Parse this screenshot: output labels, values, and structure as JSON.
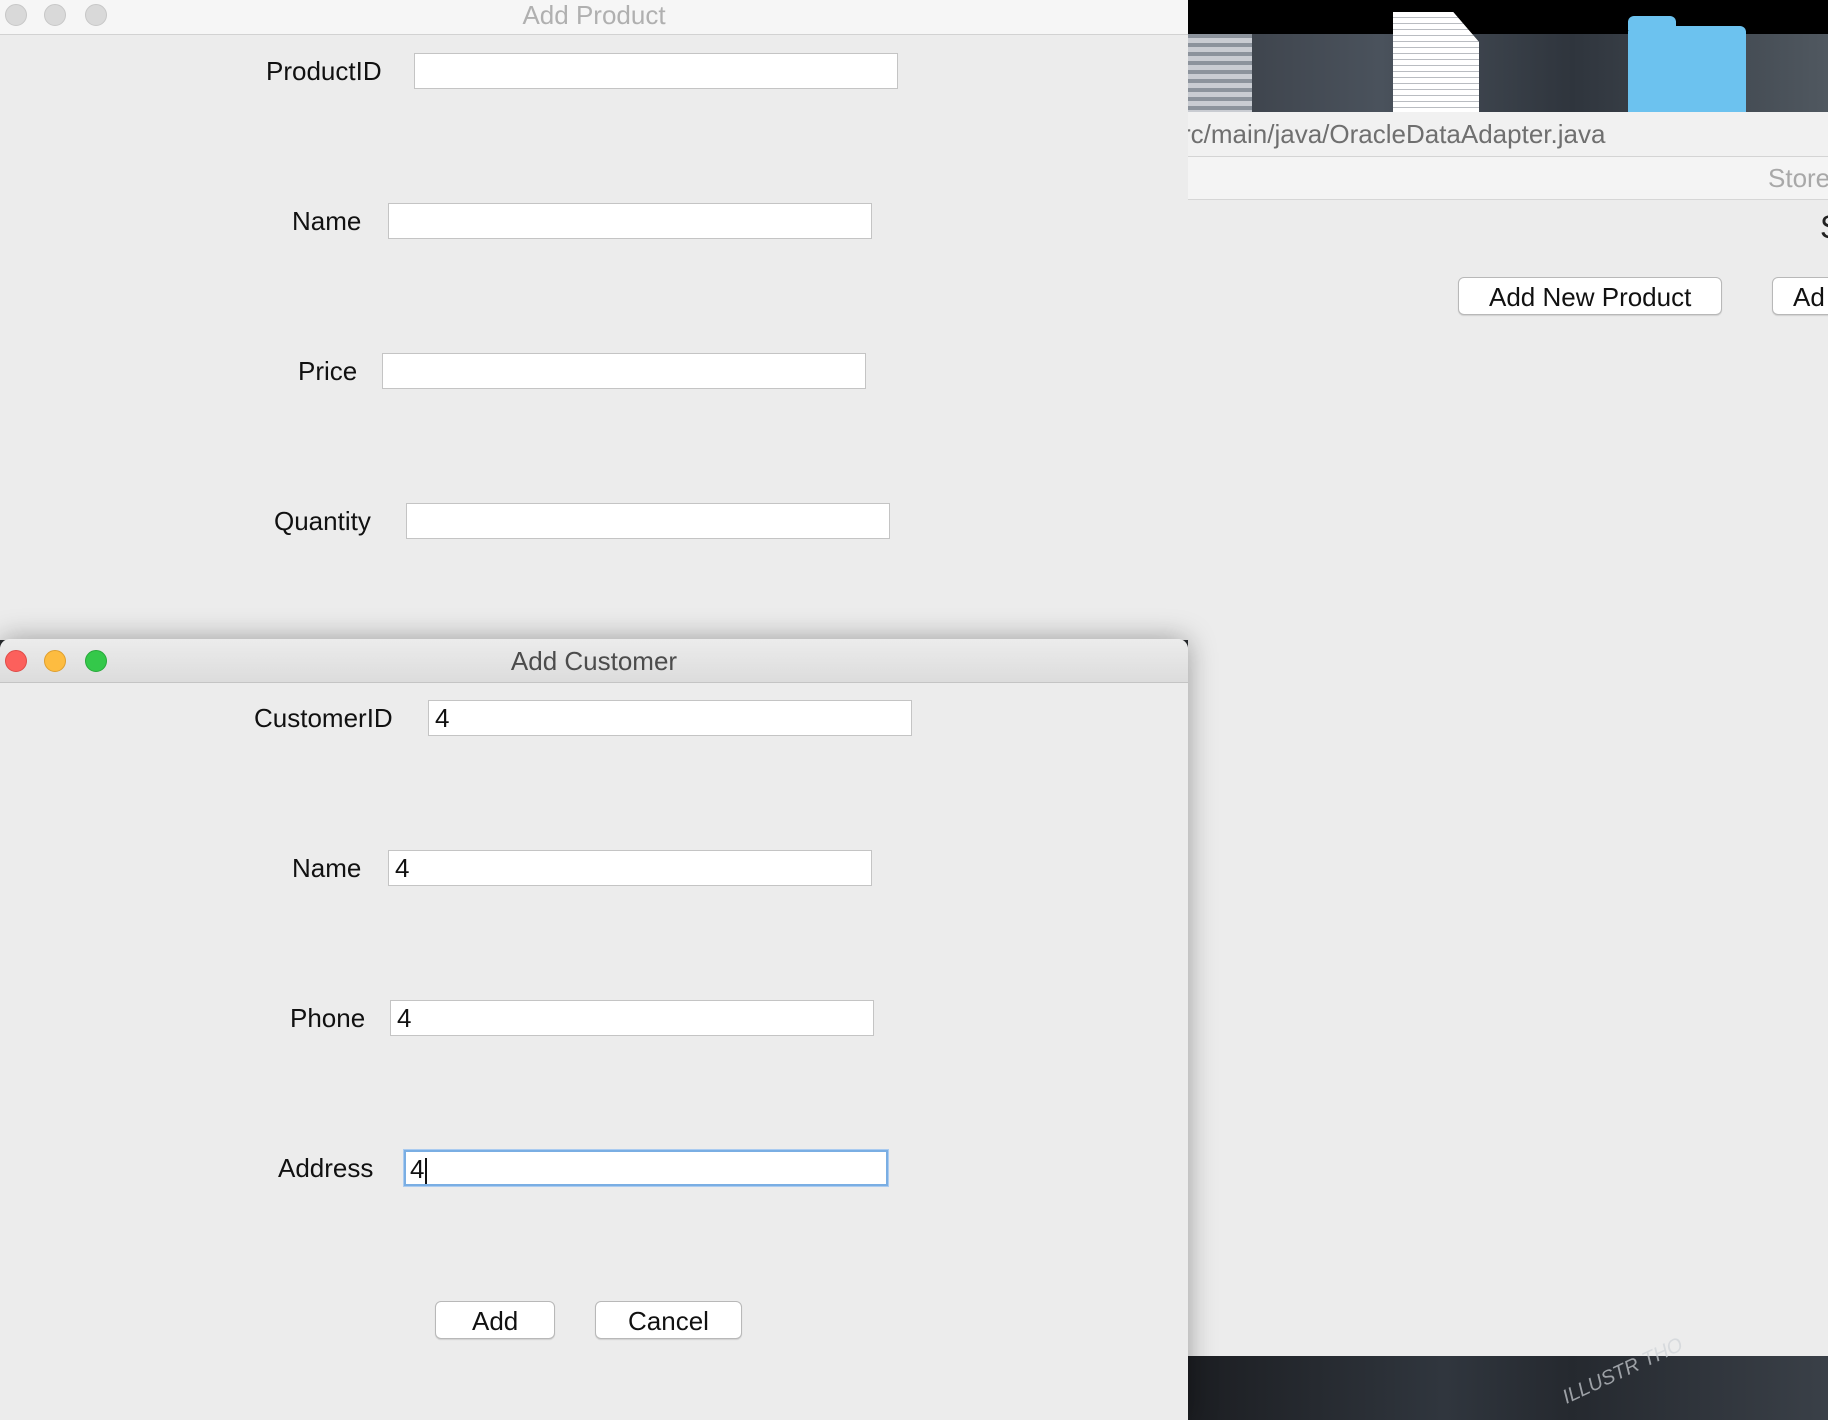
{
  "background_window": {
    "path_text": "rc/main/java/OracleDataAdapter.java",
    "store_title": "Store",
    "partial_char": "S",
    "buttons": {
      "add_new_product": "Add New Product",
      "partial_button": "Ad"
    }
  },
  "product_dialog": {
    "title": "Add Product",
    "fields": [
      {
        "label": "ProductID",
        "value": ""
      },
      {
        "label": "Name",
        "value": ""
      },
      {
        "label": "Price",
        "value": ""
      },
      {
        "label": "Quantity",
        "value": ""
      }
    ]
  },
  "customer_dialog": {
    "title": "Add Customer",
    "fields": [
      {
        "label": "CustomerID",
        "value": "4"
      },
      {
        "label": "Name",
        "value": "4"
      },
      {
        "label": "Phone",
        "value": "4"
      },
      {
        "label": "Address",
        "value": "4"
      }
    ],
    "buttons": {
      "add": "Add",
      "cancel": "Cancel"
    }
  },
  "colors": {
    "close": "#fc605c",
    "minimize": "#fdbc40",
    "zoom": "#34c84a",
    "focus_ring": "#7aaee3",
    "folder": "#6cc2ef"
  }
}
